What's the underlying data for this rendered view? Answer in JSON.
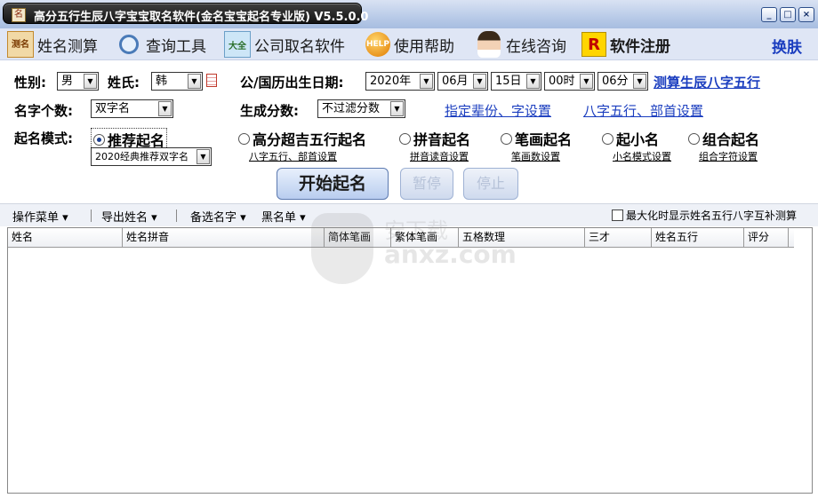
{
  "window": {
    "title": "高分五行生辰八字宝宝取名软件(金名宝宝起名专业版) V5.5.0.0",
    "icon": "app-icon",
    "buttons": [
      "minimize-icon",
      "maximize-icon",
      "close-icon"
    ]
  },
  "toolbar": {
    "items": [
      {
        "label": "姓名测算",
        "icon": "name-test-icon"
      },
      {
        "label": "查询工具",
        "icon": "magnifier-icon"
      },
      {
        "label": "公司取名软件",
        "icon": "company-icon"
      },
      {
        "label": "使用帮助",
        "icon": "help-icon"
      },
      {
        "label": "在线咨询",
        "icon": "consultant-icon"
      },
      {
        "label": "软件注册",
        "icon": "register-icon"
      }
    ],
    "skin_label": "换肤",
    "icon_texts": {
      "name_test": "测名",
      "company": "大全",
      "help": "HELP",
      "register": "R"
    }
  },
  "form": {
    "gender_label": "性别:",
    "gender_value": "男",
    "surname_label": "姓氏:",
    "surname_value": "韩",
    "birth_label": "公/国历出生日期:",
    "year": "2020年",
    "month": "06月",
    "day": "15日",
    "hour": "00时",
    "minute": "06分",
    "bazi_link": "测算生辰八字五行",
    "count_label": "名字个数:",
    "count_value": "双字名",
    "score_label": "生成分数:",
    "score_value": "不过滤分数",
    "generation_link": "指定辈份、字设置",
    "bazi_radical_link": "八字五行、部首设置",
    "mode_label": "起名模式:",
    "modes": [
      {
        "label": "推荐起名",
        "selected": true
      },
      {
        "label": "高分超吉五行起名",
        "selected": false
      },
      {
        "label": "拼音起名",
        "selected": false
      },
      {
        "label": "笔画起名",
        "selected": false
      },
      {
        "label": "起小名",
        "selected": false
      },
      {
        "label": "组合起名",
        "selected": false
      }
    ],
    "recommend_value": "2020经典推荐双字名",
    "sub_links": [
      "八字五行、部首设置",
      "拼音读音设置",
      "笔画数设置",
      "小名模式设置",
      "组合字符设置"
    ]
  },
  "actions": {
    "start": "开始起名",
    "pause": "暂停",
    "stop": "停止"
  },
  "menubar": {
    "items": [
      "操作菜单",
      "导出姓名",
      "备选名字",
      "黑名单"
    ],
    "checkbox_label": "最大化时显示姓名五行八字互补测算",
    "checkbox_checked": false
  },
  "table": {
    "columns": [
      "姓名",
      "姓名拼音",
      "简体笔画",
      "繁体笔画",
      "五格数理",
      "三才",
      "姓名五行",
      "评分"
    ]
  },
  "watermark": {
    "cn": "安下载",
    "en": "anxz.com"
  }
}
